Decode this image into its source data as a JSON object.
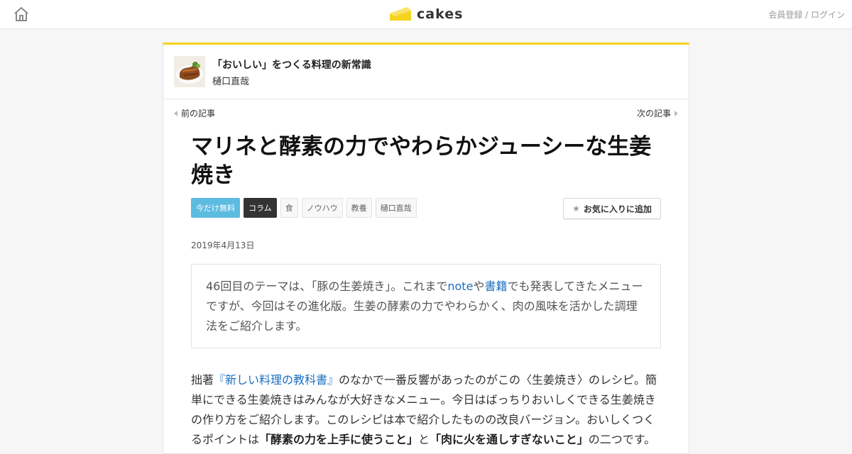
{
  "header": {
    "logo_text": "cakes",
    "login_text": "会員登録 / ログイン"
  },
  "series": {
    "title": "「おいしい」をつくる料理の新常識",
    "author": "樋口直哉"
  },
  "nav": {
    "prev": "前の記事",
    "next": "次の記事"
  },
  "article": {
    "title": "マリネと酵素の力でやわらかジューシーな生姜焼き",
    "tags": [
      "今だけ無料",
      "コラム",
      "食",
      "ノウハウ",
      "教養",
      "樋口直哉"
    ],
    "favorite_label": "お気に入りに追加",
    "date": "2019年4月13日",
    "lead": {
      "t1": "46回目のテーマは、「豚の生姜焼き」。これまで",
      "link1": "note",
      "t2": "や",
      "link2": "書籍",
      "t3": "でも発表してきたメニューですが、今回はその進化版。生姜の酵素の力でやわらかく、肉の風味を活かした調理法をご紹介します。"
    },
    "body": {
      "t1": "拙著",
      "link1": "『新しい料理の教科書』",
      "t2": "のなかで一番反響があったのがこの〈生姜焼き〉のレシピ。簡単にできる生姜焼きはみんなが大好きなメニュー。今日はばっちりおいしくできる生姜焼きの作り方をご紹介します。このレシピは本で紹介したものの改良バージョン。おいしくつくるポイントは",
      "bold1": "「酵素の力を上手に使うこと」",
      "t3": "と",
      "bold2": "「肉に火を通しすぎないこと」",
      "t4": "の二つです。"
    }
  },
  "colors": {
    "accent_yellow": "#f5d31e",
    "free_tag": "#5cbbe0",
    "link_blue": "#1a6fbf"
  }
}
